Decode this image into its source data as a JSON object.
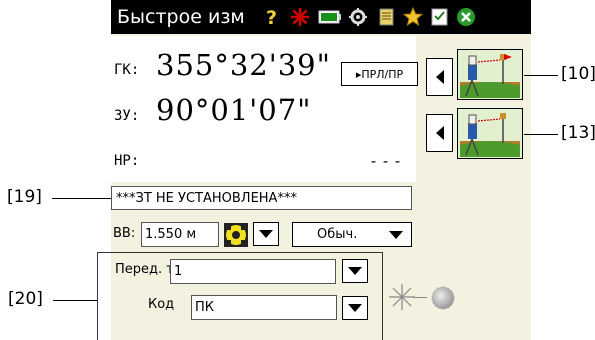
{
  "window": {
    "title": "Быстрое изм"
  },
  "toolbar": {
    "icons": [
      "help-icon",
      "laser-star-icon",
      "battery-icon",
      "settings-gear-icon",
      "notepad-icon",
      "favorites-star-icon",
      "checklist-icon",
      "close-icon"
    ]
  },
  "measurements": {
    "hz_label": "ГК:",
    "hz_value": "355°32'39\"",
    "vz_label": "ЗУ:",
    "vz_value": "90°01'07\"",
    "sd_label": "НР:",
    "sd_value": "---",
    "face_button": "▸ПРЛ/ПР"
  },
  "status": {
    "message": "***ЗТ НЕ УСТАНОВЛЕНА***"
  },
  "target_height": {
    "label": "ВВ:",
    "value": "1.550 м",
    "mode": "Обыч."
  },
  "point": {
    "label": "Перед. точка:",
    "value": "1",
    "code_label": "Код",
    "code_value": "ПК"
  },
  "callouts": {
    "c10": "[10]",
    "c13": "[13]",
    "c19": "[19]",
    "c20": "[20]"
  },
  "colors": {
    "titlebar": "#000000",
    "screen_bg": "#f3f2e0",
    "laser": "#cc0000"
  }
}
